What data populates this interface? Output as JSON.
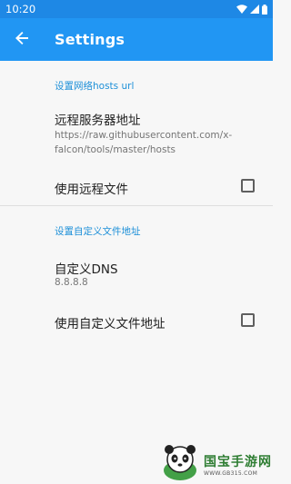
{
  "status_bar": {
    "time": "10:20",
    "icons": [
      "wifi-icon",
      "signal-icon",
      "battery-icon"
    ]
  },
  "app_bar": {
    "title": "Settings",
    "back_icon": "arrow-back-icon",
    "color": "#2196f3"
  },
  "sections": [
    {
      "header": "设置网络hosts url",
      "remote_server": {
        "title": "远程服务器地址",
        "summary": "https://raw.githubusercontent.com/x-falcon/tools/master/hosts"
      },
      "use_remote": {
        "title": "使用远程文件",
        "checked": false
      }
    },
    {
      "header": "设置自定义文件地址",
      "custom_dns": {
        "title": "自定义DNS",
        "summary": "8.8.8.8"
      },
      "use_custom": {
        "title": "使用自定义文件地址",
        "checked": false
      }
    }
  ],
  "watermark": {
    "title": "国宝手游网",
    "url": "WWW.GB315.COM"
  },
  "accent_color": "#1e90d8"
}
